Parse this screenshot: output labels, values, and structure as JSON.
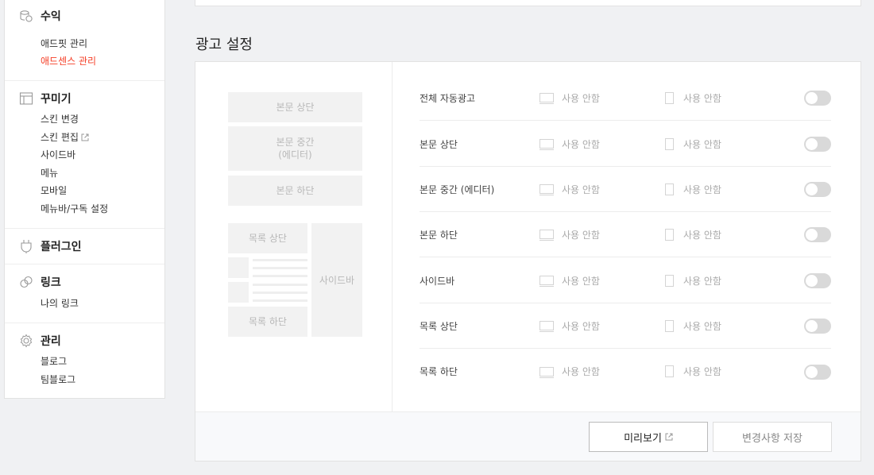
{
  "sidebar": {
    "revenue": {
      "title": "수익",
      "icon": "coins-icon",
      "items": [
        "애드핏 관리",
        "애드센스 관리"
      ]
    },
    "decorate": {
      "title": "꾸미기",
      "icon": "layout-icon",
      "items": [
        "스킨 변경",
        "스킨 편집",
        "사이드바",
        "메뉴",
        "모바일",
        "메뉴바/구독 설정"
      ]
    },
    "plugin": {
      "title": "플러그인",
      "icon": "plug-icon"
    },
    "link": {
      "title": "링크",
      "icon": "link-icon",
      "items": [
        "나의 링크"
      ]
    },
    "manage": {
      "title": "관리",
      "icon": "gear-icon",
      "items": [
        "블로그",
        "팀블로그"
      ]
    },
    "active_color": "#f53e26"
  },
  "main": {
    "heading": "광고 설정",
    "diagram": {
      "body_top": "본문 상단",
      "body_middle": "본문 중간",
      "body_middle_sub": "(에디터)",
      "body_bottom": "본문 하단",
      "list_top": "목록 상단",
      "list_bottom": "목록 하단",
      "sidebar": "사이드바"
    },
    "rows": [
      {
        "label": "전체 자동광고",
        "pc": "사용 안함",
        "mobile": "사용 안함",
        "enabled": false
      },
      {
        "label": "본문 상단",
        "pc": "사용 안함",
        "mobile": "사용 안함",
        "enabled": false
      },
      {
        "label": "본문 중간 (에디터)",
        "pc": "사용 안함",
        "mobile": "사용 안함",
        "enabled": false
      },
      {
        "label": "본문 하단",
        "pc": "사용 안함",
        "mobile": "사용 안함",
        "enabled": false
      },
      {
        "label": "사이드바",
        "pc": "사용 안함",
        "mobile": "사용 안함",
        "enabled": false
      },
      {
        "label": "목록 상단",
        "pc": "사용 안함",
        "mobile": "사용 안함",
        "enabled": false
      },
      {
        "label": "목록 하단",
        "pc": "사용 안함",
        "mobile": "사용 안함",
        "enabled": false
      }
    ],
    "buttons": {
      "preview": "미리보기",
      "save": "변경사항 저장"
    }
  }
}
